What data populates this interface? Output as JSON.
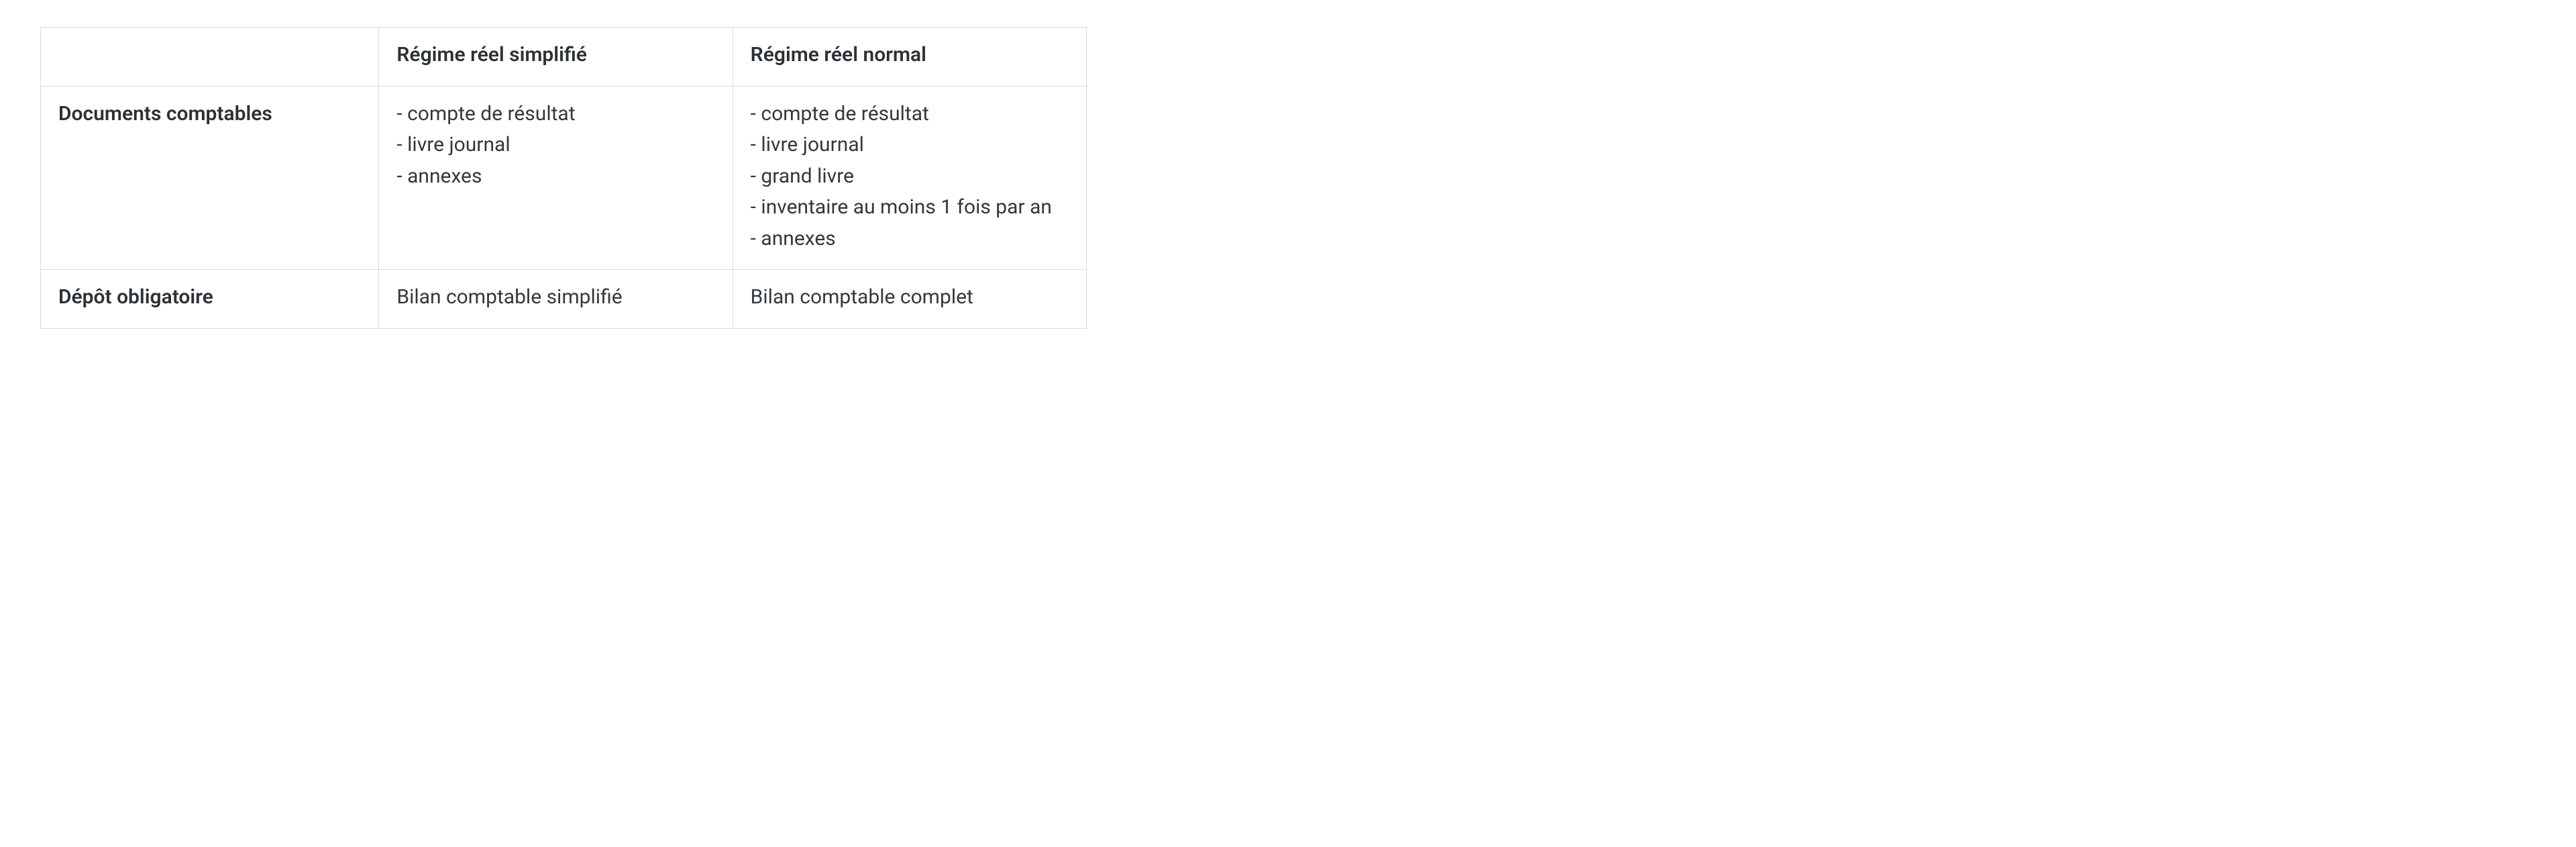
{
  "table": {
    "headers": {
      "blank": "",
      "col1": "Régime réel simplifié",
      "col2": "Régime réel normal"
    },
    "rows": [
      {
        "label": "Documents comptables",
        "col1_items": [
          "- compte de résultat",
          "- livre journal",
          "- annexes"
        ],
        "col2_items": [
          "- compte de résultat",
          "- livre journal",
          "- grand livre",
          "- inventaire au moins 1 fois par an",
          "- annexes"
        ]
      },
      {
        "label": "Dépôt obligatoire",
        "col1_text": "Bilan comptable simplifié",
        "col2_text": "Bilan comptable complet"
      }
    ]
  }
}
